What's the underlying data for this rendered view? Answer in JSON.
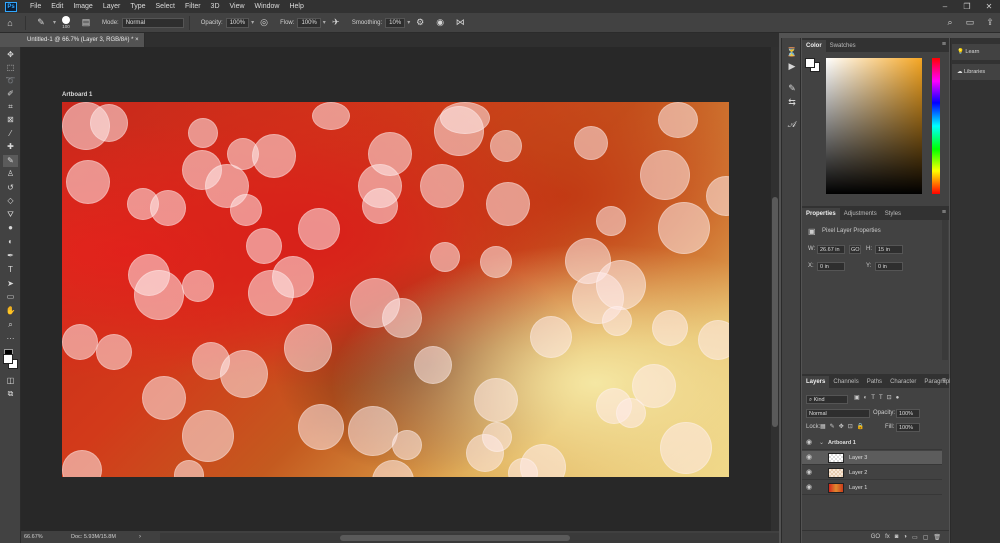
{
  "menu": [
    "File",
    "Edit",
    "Image",
    "Layer",
    "Type",
    "Select",
    "Filter",
    "3D",
    "View",
    "Window",
    "Help"
  ],
  "window_controls": [
    "–",
    "❐",
    "✕"
  ],
  "options": {
    "brush_size": "100",
    "mode_label": "Mode:",
    "mode_value": "Normal",
    "opacity_label": "Opacity:",
    "opacity_value": "100%",
    "flow_label": "Flow:",
    "flow_value": "100%",
    "smoothing_label": "Smoothing:",
    "smoothing_value": "10%"
  },
  "document": {
    "tab_title": "Untitled-1 @ 66.7% (Layer 3, RGB/8#) *",
    "tab_close": "×",
    "artboard_name": "Artboard 1"
  },
  "status": {
    "zoom": "66.67%",
    "doc": "Doc: 5.93M/15.8M",
    "arrow": "›"
  },
  "color_panel": {
    "tabs": [
      "Color",
      "Swatches"
    ]
  },
  "properties": {
    "tabs": [
      "Properties",
      "Adjustments",
      "Styles"
    ],
    "heading": "Pixel Layer Properties",
    "w_label": "W:",
    "w_value": "26.67 in",
    "link": "GO",
    "h_label": "H:",
    "h_value": "15 in",
    "x_label": "X:",
    "x_value": "0 in",
    "y_label": "Y:",
    "y_value": "0 in"
  },
  "layers_panel": {
    "tabs": [
      "Layers",
      "Channels",
      "Paths",
      "Character",
      "Paragraph"
    ],
    "filter": "Kind",
    "blend": "Normal",
    "opacity_label": "Opacity:",
    "opacity_value": "100%",
    "lock_label": "Lock:",
    "fill_label": "Fill:",
    "fill_value": "100%",
    "artboard": "Artboard 1",
    "layers": [
      "Layer 3",
      "Layer 2",
      "Layer 1"
    ],
    "selected": "Layer 3",
    "footer": [
      "GO",
      "fx",
      "◙",
      "◑",
      "▭",
      "▢",
      "🗑"
    ]
  },
  "right_panel": {
    "learn": "Learn",
    "libraries": "Libraries"
  },
  "colors": {
    "accent": "#31a8ff",
    "bg_panel": "#424242",
    "bg_dark": "#323232",
    "canvas_bg": "#282828"
  }
}
